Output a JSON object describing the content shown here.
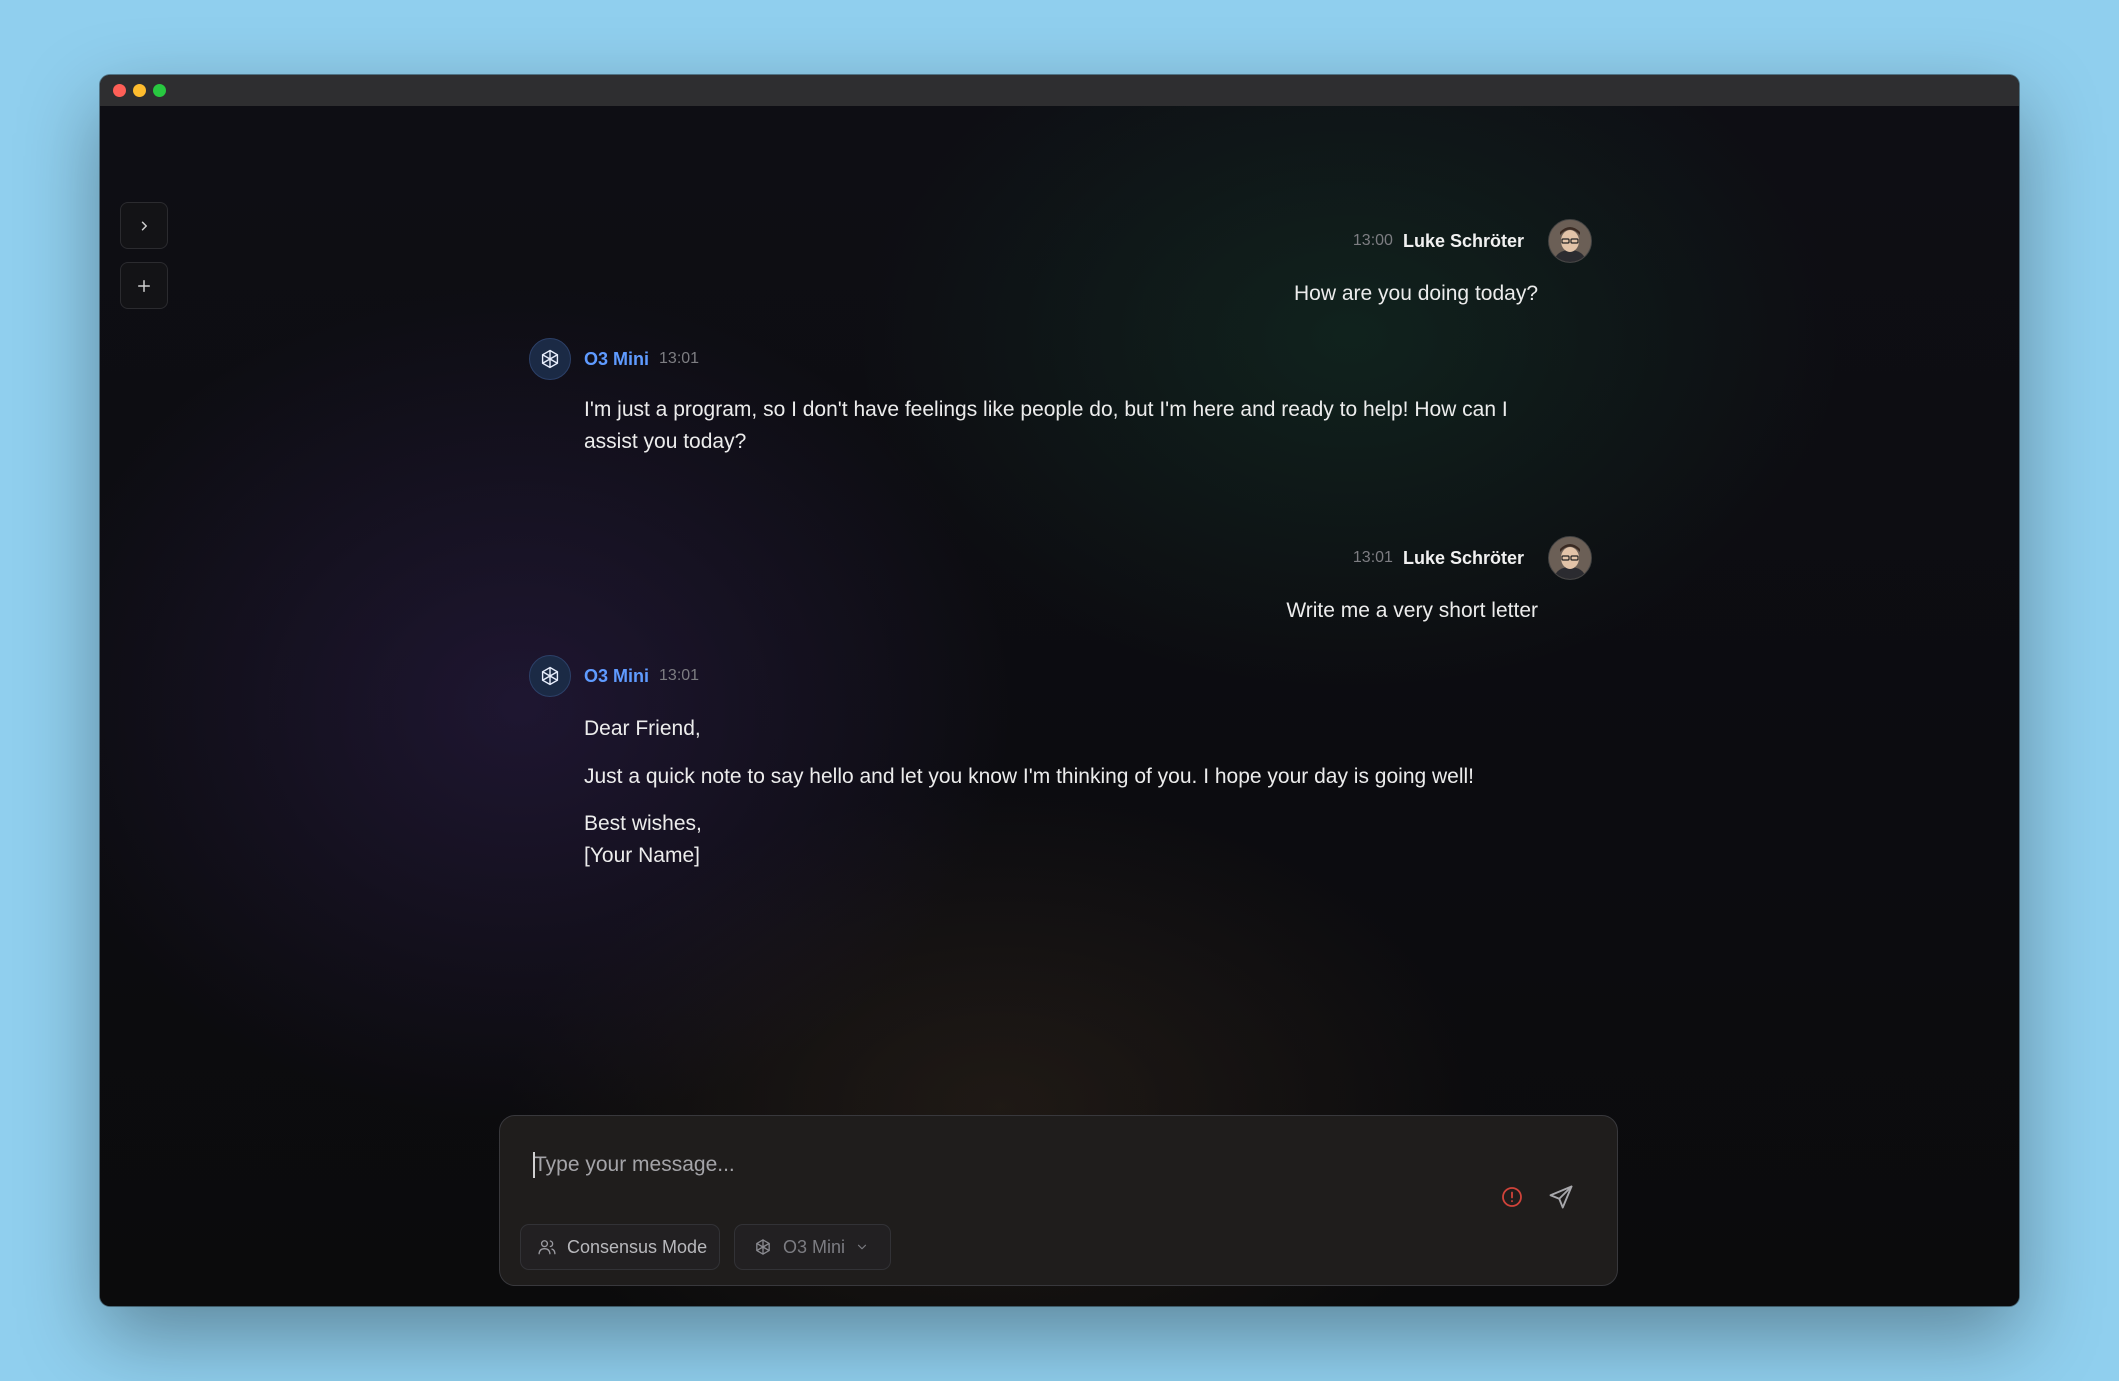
{
  "window": {
    "controls": [
      "close",
      "minimize",
      "maximize"
    ]
  },
  "sidebar": {
    "expand_icon": "chevron-right-icon",
    "new_chat_icon": "plus-icon"
  },
  "messages": [
    {
      "role": "user",
      "name": "Luke Schröter",
      "time": "13:00",
      "text": "How are you doing today?"
    },
    {
      "role": "assistant",
      "name": "O3 Mini",
      "time": "13:01",
      "lines": [
        "I'm just a program, so I don't have feelings like people do, but I'm here and ready to help! How can I",
        "assist you today?"
      ]
    },
    {
      "role": "user",
      "name": "Luke Schröter",
      "time": "13:01",
      "text": "Write me a very short letter"
    },
    {
      "role": "assistant",
      "name": "O3 Mini",
      "time": "13:01",
      "paragraphs": [
        "Dear Friend,",
        "Just a quick note to say hello and let you know I'm thinking of you. I hope your day is going well!",
        "Best wishes,",
        "[Your Name]"
      ]
    }
  ],
  "composer": {
    "placeholder": "Type your message...",
    "value": "",
    "consensus_label": "Consensus Mode",
    "model_label": "O3 Mini"
  },
  "colors": {
    "accent_blue": "#5f9bff",
    "warning_red": "#d0433a",
    "background": "#0b0b0e",
    "page_background": "#90cfee"
  }
}
